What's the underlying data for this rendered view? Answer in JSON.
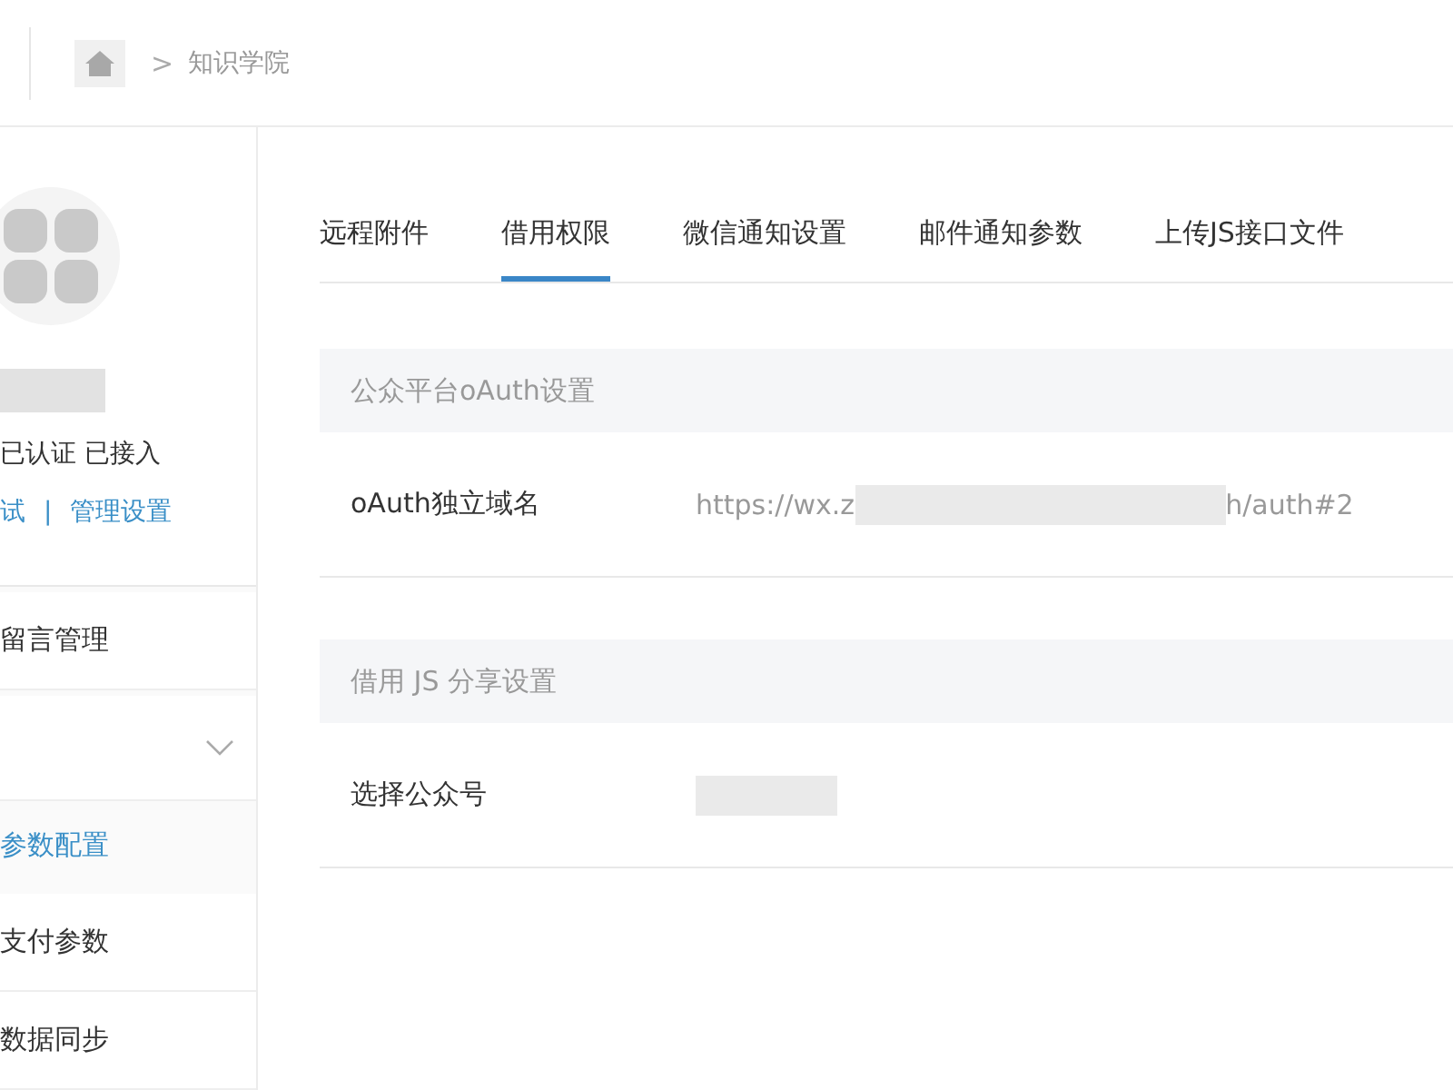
{
  "breadcrumb": {
    "separator": ">",
    "current": "知识学院"
  },
  "sidebar": {
    "account": {
      "status": "已认证 已接入",
      "links": [
        {
          "label": "试"
        },
        {
          "label": "管理设置"
        }
      ],
      "link_separator": "|"
    },
    "items": [
      {
        "kind": "item",
        "label": "留言管理"
      },
      {
        "kind": "dropdown",
        "expanded": false
      },
      {
        "kind": "heading",
        "label": "参数配置"
      },
      {
        "kind": "item",
        "label": "支付参数"
      },
      {
        "kind": "item",
        "label": "数据同步"
      }
    ]
  },
  "tabs": [
    {
      "label": "远程附件",
      "selected": false
    },
    {
      "label": "借用权限",
      "selected": true
    },
    {
      "label": "微信通知设置",
      "selected": false
    },
    {
      "label": "邮件通知参数",
      "selected": false
    },
    {
      "label": "上传JS接口文件",
      "selected": false
    }
  ],
  "sections": [
    {
      "title": "公众平台oAuth设置",
      "rows": [
        {
          "label": "oAuth独立域名",
          "value_start": "https://wx.z",
          "value_end": "h/auth#2"
        }
      ]
    },
    {
      "title": "借用 JS 分享设置",
      "rows": [
        {
          "label": "选择公众号",
          "value_start": "",
          "value_end": ""
        }
      ]
    }
  ]
}
